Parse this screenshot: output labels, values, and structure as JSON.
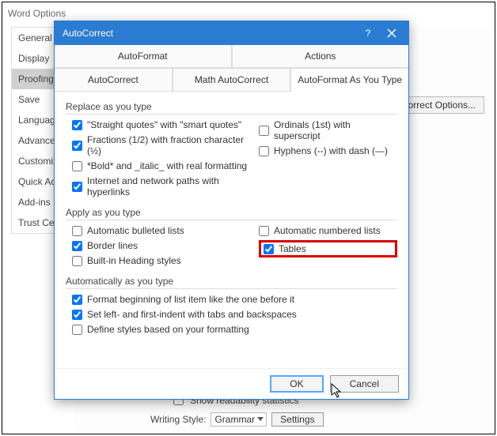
{
  "parent_window_title": "Word Options",
  "sidebar": {
    "items": [
      {
        "label": "General"
      },
      {
        "label": "Display"
      },
      {
        "label": "Proofing",
        "selected": true
      },
      {
        "label": "Save"
      },
      {
        "label": "Language"
      },
      {
        "label": "Advanced"
      },
      {
        "label": "Customize"
      },
      {
        "label": "Quick Access"
      },
      {
        "label": "Add-ins"
      },
      {
        "label": "Trust Center"
      }
    ]
  },
  "background": {
    "autocorrect_button": "orrect Options...",
    "show_readability": "Show readability statistics",
    "writing_style_label": "Writing Style:",
    "writing_style_value": "Grammar",
    "settings_button": "Settings"
  },
  "dialog": {
    "title": "AutoCorrect",
    "tabs_top": [
      "AutoFormat",
      "Actions"
    ],
    "tabs_bottom": [
      "AutoCorrect",
      "Math AutoCorrect",
      "AutoFormat As You Type"
    ],
    "active_tab": "AutoFormat As You Type",
    "groups": {
      "replace": {
        "title": "Replace as you type",
        "left": [
          {
            "label": "\"Straight quotes\" with \"smart quotes\"",
            "checked": true
          },
          {
            "label": "Fractions (1/2) with fraction character (½)",
            "checked": true
          },
          {
            "label": "*Bold* and _italic_ with real formatting",
            "checked": false
          },
          {
            "label": "Internet and network paths with hyperlinks",
            "checked": true
          }
        ],
        "right": [
          {
            "label": "Ordinals (1st) with superscript",
            "checked": false
          },
          {
            "label": "Hyphens (--) with dash (—)",
            "checked": false
          }
        ]
      },
      "apply": {
        "title": "Apply as you type",
        "left": [
          {
            "label": "Automatic bulleted lists",
            "checked": false
          },
          {
            "label": "Border lines",
            "checked": true
          },
          {
            "label": "Built-in Heading styles",
            "checked": false
          }
        ],
        "right": [
          {
            "label": "Automatic numbered lists",
            "checked": false
          },
          {
            "label": "Tables",
            "checked": true,
            "highlight": true
          }
        ]
      },
      "auto": {
        "title": "Automatically as you type",
        "items": [
          {
            "label": "Format beginning of list item like the one before it",
            "checked": true
          },
          {
            "label": "Set left- and first-indent with tabs and backspaces",
            "checked": true
          },
          {
            "label": "Define styles based on your formatting",
            "checked": false
          }
        ]
      }
    },
    "buttons": {
      "ok": "OK",
      "cancel": "Cancel"
    }
  }
}
